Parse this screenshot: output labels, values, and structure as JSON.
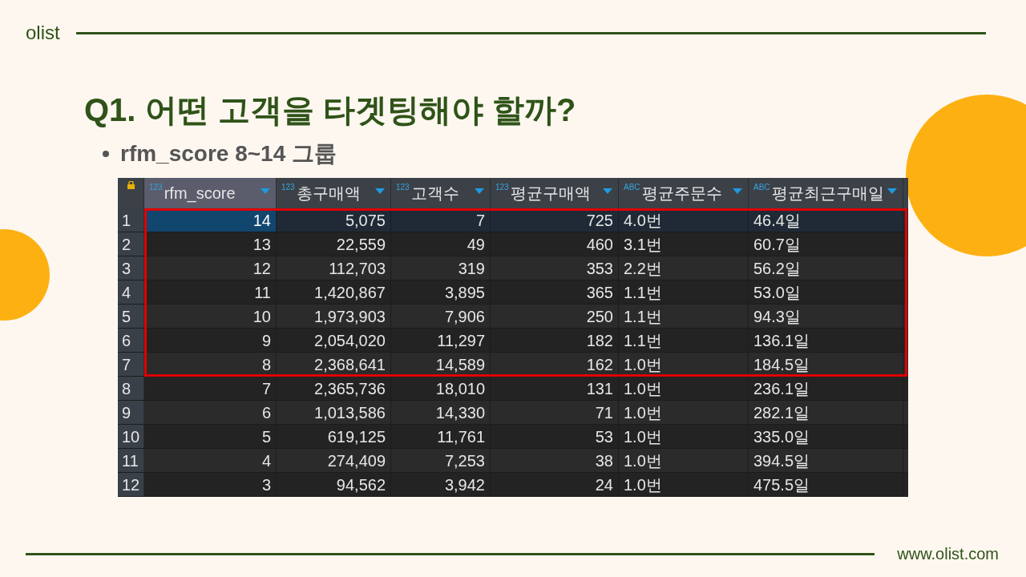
{
  "header": {
    "brand": "olist"
  },
  "title": "Q1. 어떤 고객을 타겟팅해야 할까?",
  "bullets": [
    "rfm_score 8~14 그룹"
  ],
  "grid": {
    "columns": [
      {
        "label": "rfm_score",
        "type_label": "123",
        "kind": "number",
        "selected": true
      },
      {
        "label": "총구매액",
        "type_label": "123",
        "kind": "number",
        "selected": false
      },
      {
        "label": "고객수",
        "type_label": "123",
        "kind": "number",
        "selected": false
      },
      {
        "label": "평균구매액",
        "type_label": "123",
        "kind": "number",
        "selected": false
      },
      {
        "label": "평균주문수",
        "type_label": "ABC",
        "kind": "text",
        "selected": false
      },
      {
        "label": "평균최근구매일",
        "type_label": "ABC",
        "kind": "text",
        "selected": false
      }
    ],
    "rows": [
      {
        "num": "1",
        "selected": true,
        "boxed": true,
        "cells": [
          "14",
          "5,075",
          "7",
          "725",
          "4.0번",
          "46.4일"
        ]
      },
      {
        "num": "2",
        "selected": false,
        "boxed": true,
        "cells": [
          "13",
          "22,559",
          "49",
          "460",
          "3.1번",
          "60.7일"
        ]
      },
      {
        "num": "3",
        "selected": false,
        "boxed": true,
        "cells": [
          "12",
          "112,703",
          "319",
          "353",
          "2.2번",
          "56.2일"
        ]
      },
      {
        "num": "4",
        "selected": false,
        "boxed": true,
        "cells": [
          "11",
          "1,420,867",
          "3,895",
          "365",
          "1.1번",
          "53.0일"
        ]
      },
      {
        "num": "5",
        "selected": false,
        "boxed": true,
        "cells": [
          "10",
          "1,973,903",
          "7,906",
          "250",
          "1.1번",
          "94.3일"
        ]
      },
      {
        "num": "6",
        "selected": false,
        "boxed": true,
        "cells": [
          "9",
          "2,054,020",
          "11,297",
          "182",
          "1.1번",
          "136.1일"
        ]
      },
      {
        "num": "7",
        "selected": false,
        "boxed": true,
        "cells": [
          "8",
          "2,368,641",
          "14,589",
          "162",
          "1.0번",
          "184.5일"
        ]
      },
      {
        "num": "8",
        "selected": false,
        "boxed": false,
        "cells": [
          "7",
          "2,365,736",
          "18,010",
          "131",
          "1.0번",
          "236.1일"
        ]
      },
      {
        "num": "9",
        "selected": false,
        "boxed": false,
        "cells": [
          "6",
          "1,013,586",
          "14,330",
          "71",
          "1.0번",
          "282.1일"
        ]
      },
      {
        "num": "10",
        "selected": false,
        "boxed": false,
        "cells": [
          "5",
          "619,125",
          "11,761",
          "53",
          "1.0번",
          "335.0일"
        ]
      },
      {
        "num": "11",
        "selected": false,
        "boxed": false,
        "cells": [
          "4",
          "274,409",
          "7,253",
          "38",
          "1.0번",
          "394.5일"
        ]
      },
      {
        "num": "12",
        "selected": false,
        "boxed": false,
        "cells": [
          "3",
          "94,562",
          "3,942",
          "24",
          "1.0번",
          "475.5일"
        ]
      }
    ]
  },
  "footer": {
    "url": "www.olist.com"
  }
}
